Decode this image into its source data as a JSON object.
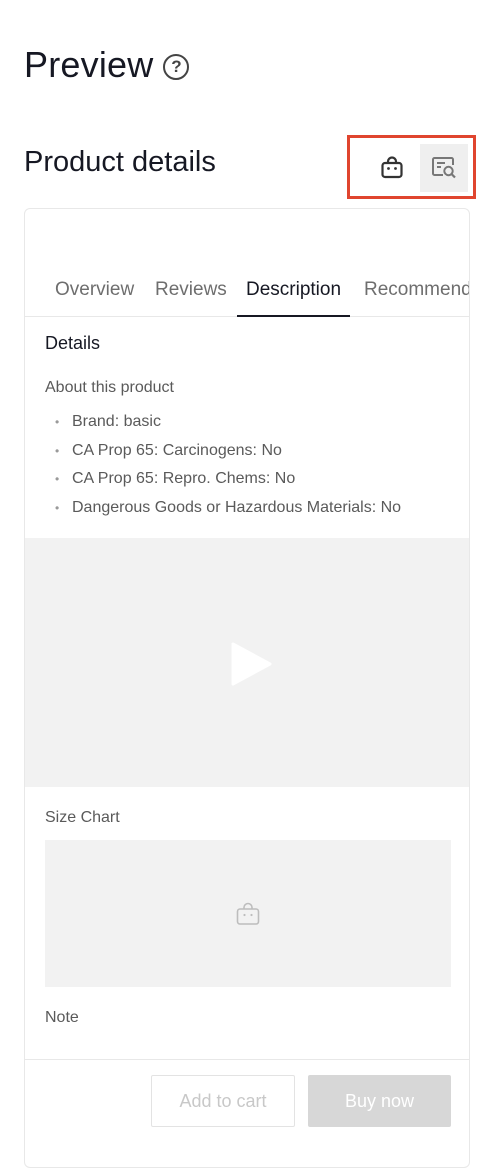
{
  "header": {
    "title": "Preview",
    "help_icon": "question-circle-icon"
  },
  "section": {
    "title": "Product details"
  },
  "view_toggle": {
    "shop_icon": "shopping-bag-icon",
    "search_icon": "search-window-icon",
    "highlight_color": "#e0452f"
  },
  "tabs": [
    {
      "label": "Overview"
    },
    {
      "label": "Reviews"
    },
    {
      "label": "Description"
    },
    {
      "label": "Recommendations"
    }
  ],
  "description": {
    "details_title": "Details",
    "about_title": "About this product",
    "attributes": [
      "Brand: basic",
      "CA Prop 65: Carcinogens: No",
      "CA Prop 65: Repro. Chems: No",
      "Dangerous Goods or Hazardous Materials: No"
    ],
    "video_icon": "play-icon",
    "size_chart_label": "Size Chart",
    "size_chart_placeholder_icon": "shopping-bag-icon",
    "note_label": "Note"
  },
  "footer": {
    "add_to_cart_label": "Add to cart",
    "buy_now_label": "Buy now"
  }
}
